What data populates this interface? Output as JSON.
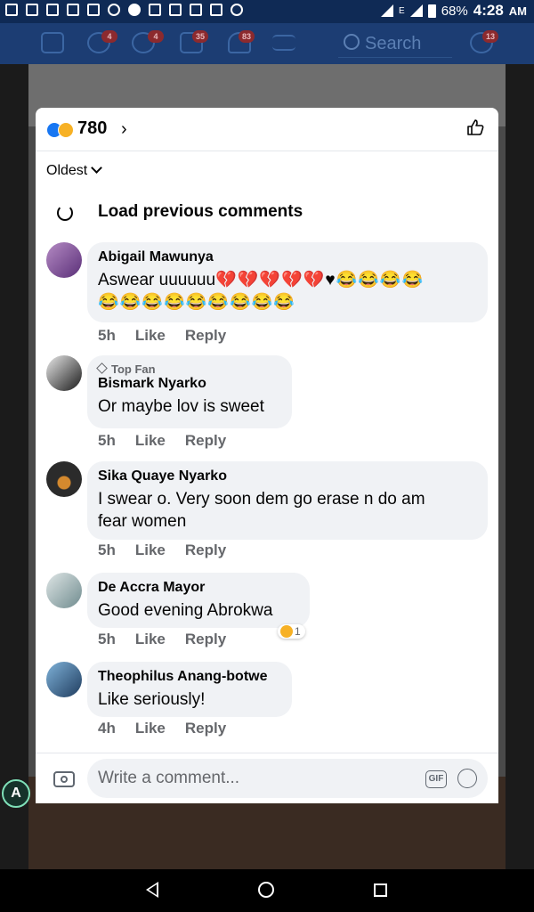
{
  "status_bar": {
    "battery": "68%",
    "network": "E",
    "time": "4:28",
    "ampm": "AM"
  },
  "fb_nav": {
    "search_placeholder": "Search",
    "badges": {
      "friends": "4",
      "groups": "4",
      "watch": "35",
      "notifications": "83",
      "messenger": "13"
    }
  },
  "reactions": {
    "count": "780",
    "icons": [
      "like-icon",
      "haha-icon"
    ]
  },
  "sort": {
    "label": "Oldest"
  },
  "load_previous": {
    "label": "Load previous comments"
  },
  "comments": [
    {
      "author": "Abigail Mawunya",
      "text": "Aswear uuuuuu",
      "emoji_line1": "💔💔💔💔💔♥😂😂😂😂",
      "emoji_line2": "😂😂😂😂😂😂😂😂😂",
      "time": "5h",
      "like": "Like",
      "reply": "Reply",
      "avatar_color": "#6b3b8f"
    },
    {
      "badge": "Top Fan",
      "author": "Bismark Nyarko",
      "text": "Or maybe lov is sweet",
      "time": "5h",
      "like": "Like",
      "reply": "Reply",
      "avatar_color": "#2b2b2b"
    },
    {
      "author": "Sika Quaye Nyarko",
      "text_line1": "I swear o. Very soon dem go erase n do am",
      "text_line2": "fear women",
      "time": "5h",
      "like": "Like",
      "reply": "Reply",
      "avatar_color": "#1a1a1a"
    },
    {
      "author": "De Accra Mayor",
      "text": "Good evening Abrokwa",
      "time": "5h",
      "like": "Like",
      "reply": "Reply",
      "reaction_count": "1",
      "avatar_color": "#9ca7a8"
    },
    {
      "author": "Theophilus Anang-botwe",
      "text": "Like seriously!",
      "time": "4h",
      "like": "Like",
      "reply": "Reply",
      "avatar_color": "#2f6f9e"
    }
  ],
  "composer": {
    "placeholder": "Write a comment...",
    "gif_label": "GIF"
  },
  "side_button": {
    "label": "A"
  },
  "colors": {
    "facebook_blue": "#1877f2",
    "nav_bg": "#1c3d73",
    "bubble_bg": "#f0f2f5",
    "meta_gray": "#65676b"
  }
}
